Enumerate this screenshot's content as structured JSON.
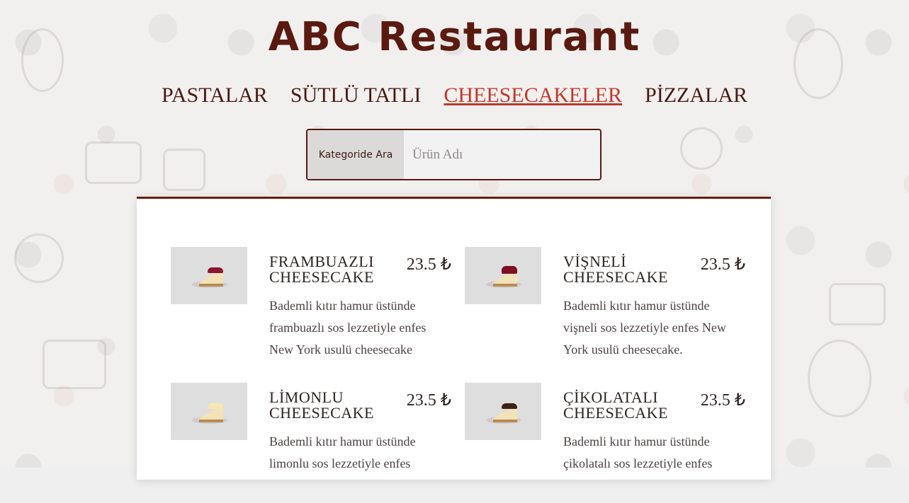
{
  "brand": "ABC Restaurant",
  "tabs": [
    {
      "label": "PASTALAR",
      "active": false
    },
    {
      "label": "SÜTLÜ TATLI",
      "active": false
    },
    {
      "label": "CHEESECAKELER",
      "active": true
    },
    {
      "label": "PİZZALAR",
      "active": false
    }
  ],
  "search": {
    "label": "Kategoride Ara",
    "placeholder": "Ürün Adı"
  },
  "products": [
    {
      "name": "FRAMBUAZLI CHEESECAKE",
      "price": "23.5 ₺",
      "description": "Bademli kıtır hamur üstünde frambuazlı sos lezzetiyle enfes New York usulü cheesecake",
      "topping_color": "#8c1530"
    },
    {
      "name": "VİŞNELİ CHEESECAKE",
      "price": "23.5 ₺",
      "description": "Bademli kıtır hamur üstünde vişneli sos lezzetiyle enfes New York usulü cheesecake.",
      "topping_color": "#7a1022"
    },
    {
      "name": "LİMONLU CHEESECAKE",
      "price": "23.5 ₺",
      "description": "Bademli kıtır hamur üstünde limonlu sos lezzetiyle enfes",
      "topping_color": "#f5e7b0"
    },
    {
      "name": "ÇİKOLATALI CHEESECAKE",
      "price": "23.5 ₺",
      "description": "Bademli kıtır hamur üstünde çikolatalı sos lezzetiyle enfes",
      "topping_color": "#3a2418"
    }
  ],
  "colors": {
    "brand": "#5a1a10",
    "active_tab": "#c0392b",
    "panel_border": "#6b1e12"
  }
}
